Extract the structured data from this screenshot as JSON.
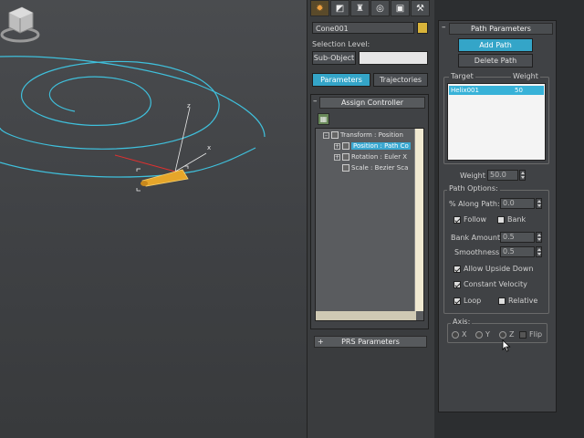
{
  "toolbar": {
    "tabs": [
      {
        "icon": "create-icon",
        "glyph": "✹"
      },
      {
        "icon": "modify-icon",
        "glyph": "◩"
      },
      {
        "icon": "hierarchy-icon",
        "glyph": "♜"
      },
      {
        "icon": "motion-icon",
        "glyph": "◎"
      },
      {
        "icon": "display-icon",
        "glyph": "▣"
      },
      {
        "icon": "utilities-icon",
        "glyph": "⚒"
      }
    ]
  },
  "object": {
    "name": "Cone001",
    "color": "#d9b43a"
  },
  "selection": {
    "label": "Selection Level:",
    "sub_object_button": "Sub-Object",
    "sub_object_value": ""
  },
  "motion_tabs": {
    "parameters": "Parameters",
    "trajectories": "Trajectories"
  },
  "assign_controller": {
    "title": "Assign Controller",
    "minus": "–",
    "tree": [
      {
        "text": "Transform : Position",
        "level": 0,
        "expander": "–"
      },
      {
        "text": "Position : Path Co",
        "level": 1,
        "expander": "+",
        "selected": true
      },
      {
        "text": "Rotation : Euler X",
        "level": 1,
        "expander": "+"
      },
      {
        "text": "Scale : Bezier Sca",
        "level": 1,
        "expander": ""
      }
    ]
  },
  "prs": {
    "title": "PRS Parameters",
    "plus": "+"
  },
  "path_parameters": {
    "title": "Path Parameters",
    "minus": "–",
    "add_path": "Add Path",
    "delete_path": "Delete Path",
    "target_header": "Target",
    "weight_header": "Weight",
    "targets": [
      {
        "target": "Helix001",
        "weight": "50"
      }
    ],
    "weight_label": "Weight",
    "weight_value": "50.0",
    "path_options_title": "Path Options:",
    "along_path_label": "% Along Path:",
    "along_path_value": "0.0",
    "follow": {
      "label": "Follow",
      "checked": true
    },
    "bank": {
      "label": "Bank",
      "checked": false
    },
    "bank_amount_label": "Bank Amount:",
    "bank_amount_value": "0.5",
    "smoothness_label": "Smoothness:",
    "smoothness_value": "0.5",
    "allow_upside_down": {
      "label": "Allow Upside Down",
      "checked": true
    },
    "constant_velocity": {
      "label": "Constant Velocity",
      "checked": true
    },
    "loop": {
      "label": "Loop",
      "checked": true
    },
    "relative": {
      "label": "Relative",
      "checked": false
    },
    "axis_title": "Axis:",
    "axis_x": "X",
    "axis_y": "Y",
    "axis_z": "Z",
    "flip": {
      "label": "Flip",
      "checked": false
    }
  },
  "viewport": {
    "gizmo_labels": {
      "x": "x",
      "z": "z"
    }
  }
}
